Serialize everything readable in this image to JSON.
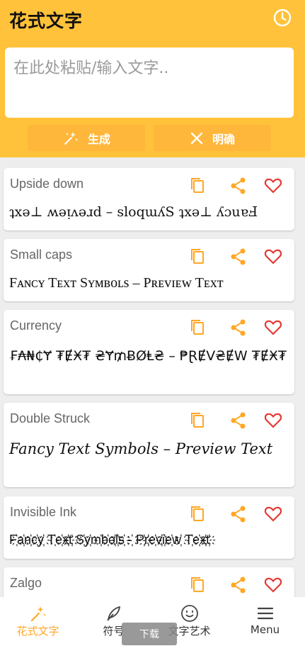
{
  "app": {
    "title": "花式文字"
  },
  "input": {
    "placeholder": "在此处粘贴/输入文字.."
  },
  "actions": {
    "generate_label": "生成",
    "clear_label": "明确"
  },
  "colors": {
    "header": "#ffc23a",
    "accent": "#ffb73b",
    "icon_orange": "#ffa726",
    "heart_red": "#e53935"
  },
  "cards": [
    {
      "label": "Upside down",
      "text": "ʇxǝ⊥ ʍǝᴉʌǝɹd – sloqɯʎS ʇxǝ⊥ ʎɔuɐℲ"
    },
    {
      "label": "Small caps",
      "text": "Fᴀɴᴄʏ Tᴇxᴛ Sʏᴍʙᴏʟs – Pʀᴇᴠɪᴇᴡ Tᴇxᴛ"
    },
    {
      "label": "Currency",
      "text": "₣₳₦₵Ɏ ₮ɆӾ₮ ₴Ɏ₥ɃØⱠ₴ – ₱ⱤɆV₴ɆW ₮ɆӾ₮"
    },
    {
      "label": "Double Struck",
      "text": "Fancy Text Symbols – Preview Text"
    },
    {
      "label": "Invisible Ink",
      "text": "F҉a҉n҉c҉y҉ T҉e҉x҉t҉ S҉y҉m҉b҉o҉l҉s҉ -҉ P҉r҉e҉v҉i҉e҉w҉ T҉e҉x҉t҉"
    },
    {
      "label": "Zalgo",
      "text": ""
    }
  ],
  "nav": [
    {
      "label": "花式文字",
      "icon": "magic-wand-icon",
      "active": true
    },
    {
      "label": "符号",
      "icon": "feather-icon",
      "active": false
    },
    {
      "label": "文字艺术",
      "icon": "smiley-icon",
      "active": false
    },
    {
      "label": "Menu",
      "icon": "hamburger-icon",
      "active": false
    }
  ],
  "overlay": {
    "download_label": "下载"
  }
}
